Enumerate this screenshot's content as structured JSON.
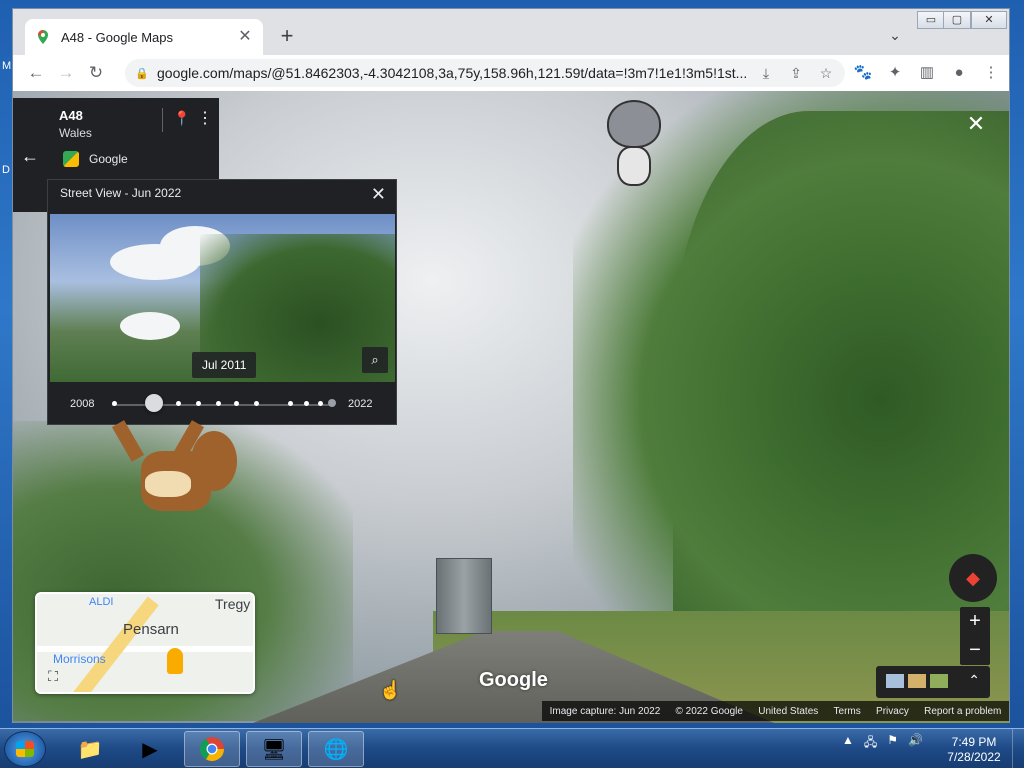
{
  "browser": {
    "tab_title": "A48 - Google Maps",
    "new_tab": "+",
    "url": "google.com/maps/@51.8462303,-4.3042108,3a,75y,158.96h,121.59t/data=!3m7!1e1!3m5!1st..."
  },
  "location_card": {
    "name": "A48",
    "region": "Wales",
    "source": "Google"
  },
  "time_travel": {
    "header": "Street View - Jun 2022",
    "date_chip": "Jul 2011",
    "year_start": "2008",
    "year_end": "2022",
    "selected_fraction": 0.18
  },
  "minimap": {
    "labels": [
      "ALDI",
      "Tregy",
      "Pensarn",
      "Morrisons"
    ]
  },
  "watermark": "Google",
  "footer": [
    "Image capture: Jun 2022",
    "© 2022 Google",
    "United States",
    "Terms",
    "Privacy",
    "Report a problem"
  ],
  "taskbar": {
    "time": "7:49 PM",
    "date": "7/28/2022"
  },
  "desktop_fragments": [
    "M",
    "D"
  ],
  "icons": {
    "back": "arrow-left-icon",
    "forward": "arrow-right-icon",
    "reload": "reload-icon",
    "lock": "lock-icon",
    "exit": "close-icon"
  }
}
